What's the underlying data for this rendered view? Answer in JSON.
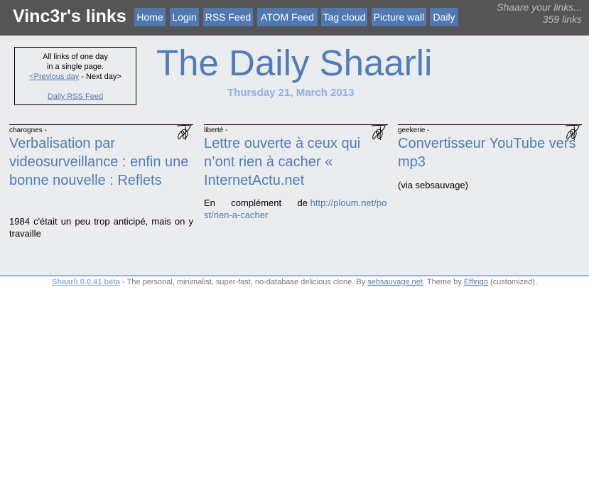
{
  "header": {
    "site_title": "Vinc3r's links",
    "tagline": "Shaare your links...",
    "link_count": "359 links",
    "nav": [
      "Home",
      "Login",
      "RSS Feed",
      "ATOM Feed",
      "Tag cloud",
      "Picture wall",
      "Daily"
    ]
  },
  "about_box": {
    "line1": "All links of one day",
    "line2": "in a single page.",
    "prev_day": "<Previous day",
    "separator": " - Next day>",
    "rss": "Daily RSS Feed"
  },
  "daily": {
    "title": "The Daily Shaarli",
    "date": "Thursday 21, March 2013"
  },
  "links": [
    {
      "tag": "charognes -",
      "title": "Verbalisation par videosurveillance : enfin une bonne nouvelle : Reflets",
      "desc": "1984 c'était un peu trop anticipé, mais on y travaille"
    },
    {
      "tag": "liberté -",
      "title": "Lettre ouverte à ceux qui n’ont rien à cacher « InternetActu.net",
      "desc_prefix": "En complément de",
      "desc_link": "http://ploum.net/post/rien-a-cacher"
    },
    {
      "tag": "geekerie -",
      "title": "Convertisseur YouTube vers mp3",
      "desc": "(via sebsauvage)"
    }
  ],
  "footer": {
    "shaarli": "Shaarli 0.0.41 beta",
    "text1": " - The personal, minimalist, super-fast, no-database delicious clone. By ",
    "author": "sebsauvage.net",
    "text2": ". Theme by ",
    "theme_author": "Effingo",
    "text3": " (customized)."
  },
  "colors": {
    "header_bg": "#555555",
    "nav_bg": "#4f79b2",
    "panel_bg": "#ebeced",
    "title_blue": "#4f7cbc",
    "date_blue": "#8eb0e6"
  }
}
